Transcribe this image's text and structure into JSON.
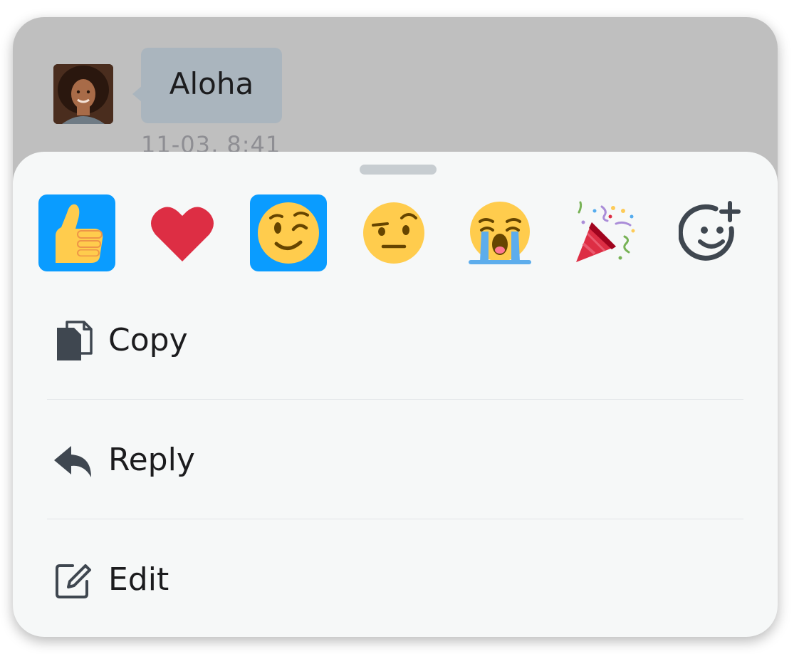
{
  "message": {
    "text": "Aloha",
    "timestamp": "11-03, 8:41",
    "avatar_icon": "user-avatar"
  },
  "reactions": [
    {
      "name": "thumbs-up",
      "selected": true
    },
    {
      "name": "red-heart",
      "selected": false
    },
    {
      "name": "winking-face",
      "selected": true
    },
    {
      "name": "face-with-raised-eyebrow",
      "selected": false
    },
    {
      "name": "loudly-crying-face",
      "selected": false
    },
    {
      "name": "party-popper",
      "selected": false
    },
    {
      "name": "add-reaction",
      "selected": false
    }
  ],
  "menu": [
    {
      "label": "Copy",
      "icon": "copy-icon"
    },
    {
      "label": "Reply",
      "icon": "reply-icon"
    },
    {
      "label": "Edit",
      "icon": "edit-icon"
    }
  ],
  "colors": {
    "accent": "#0a9cff",
    "sheet_background": "#f6f8f8",
    "overlay": "#bfbfbf",
    "bubble": "#aab5be"
  }
}
